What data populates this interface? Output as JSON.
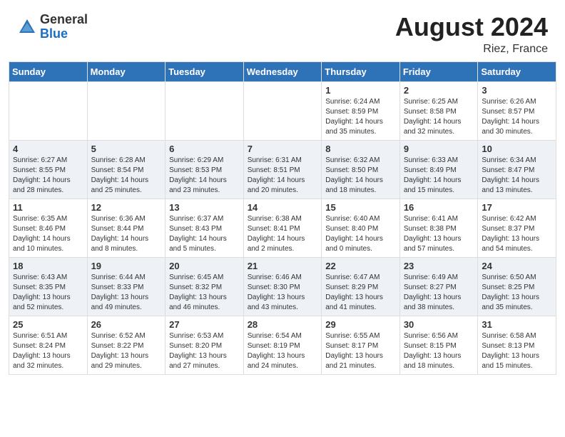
{
  "header": {
    "logo_general": "General",
    "logo_blue": "Blue",
    "month_year": "August 2024",
    "location": "Riez, France"
  },
  "weekdays": [
    "Sunday",
    "Monday",
    "Tuesday",
    "Wednesday",
    "Thursday",
    "Friday",
    "Saturday"
  ],
  "weeks": [
    [
      {
        "day": "",
        "info": ""
      },
      {
        "day": "",
        "info": ""
      },
      {
        "day": "",
        "info": ""
      },
      {
        "day": "",
        "info": ""
      },
      {
        "day": "1",
        "info": "Sunrise: 6:24 AM\nSunset: 8:59 PM\nDaylight: 14 hours\nand 35 minutes."
      },
      {
        "day": "2",
        "info": "Sunrise: 6:25 AM\nSunset: 8:58 PM\nDaylight: 14 hours\nand 32 minutes."
      },
      {
        "day": "3",
        "info": "Sunrise: 6:26 AM\nSunset: 8:57 PM\nDaylight: 14 hours\nand 30 minutes."
      }
    ],
    [
      {
        "day": "4",
        "info": "Sunrise: 6:27 AM\nSunset: 8:55 PM\nDaylight: 14 hours\nand 28 minutes."
      },
      {
        "day": "5",
        "info": "Sunrise: 6:28 AM\nSunset: 8:54 PM\nDaylight: 14 hours\nand 25 minutes."
      },
      {
        "day": "6",
        "info": "Sunrise: 6:29 AM\nSunset: 8:53 PM\nDaylight: 14 hours\nand 23 minutes."
      },
      {
        "day": "7",
        "info": "Sunrise: 6:31 AM\nSunset: 8:51 PM\nDaylight: 14 hours\nand 20 minutes."
      },
      {
        "day": "8",
        "info": "Sunrise: 6:32 AM\nSunset: 8:50 PM\nDaylight: 14 hours\nand 18 minutes."
      },
      {
        "day": "9",
        "info": "Sunrise: 6:33 AM\nSunset: 8:49 PM\nDaylight: 14 hours\nand 15 minutes."
      },
      {
        "day": "10",
        "info": "Sunrise: 6:34 AM\nSunset: 8:47 PM\nDaylight: 14 hours\nand 13 minutes."
      }
    ],
    [
      {
        "day": "11",
        "info": "Sunrise: 6:35 AM\nSunset: 8:46 PM\nDaylight: 14 hours\nand 10 minutes."
      },
      {
        "day": "12",
        "info": "Sunrise: 6:36 AM\nSunset: 8:44 PM\nDaylight: 14 hours\nand 8 minutes."
      },
      {
        "day": "13",
        "info": "Sunrise: 6:37 AM\nSunset: 8:43 PM\nDaylight: 14 hours\nand 5 minutes."
      },
      {
        "day": "14",
        "info": "Sunrise: 6:38 AM\nSunset: 8:41 PM\nDaylight: 14 hours\nand 2 minutes."
      },
      {
        "day": "15",
        "info": "Sunrise: 6:40 AM\nSunset: 8:40 PM\nDaylight: 14 hours\nand 0 minutes."
      },
      {
        "day": "16",
        "info": "Sunrise: 6:41 AM\nSunset: 8:38 PM\nDaylight: 13 hours\nand 57 minutes."
      },
      {
        "day": "17",
        "info": "Sunrise: 6:42 AM\nSunset: 8:37 PM\nDaylight: 13 hours\nand 54 minutes."
      }
    ],
    [
      {
        "day": "18",
        "info": "Sunrise: 6:43 AM\nSunset: 8:35 PM\nDaylight: 13 hours\nand 52 minutes."
      },
      {
        "day": "19",
        "info": "Sunrise: 6:44 AM\nSunset: 8:33 PM\nDaylight: 13 hours\nand 49 minutes."
      },
      {
        "day": "20",
        "info": "Sunrise: 6:45 AM\nSunset: 8:32 PM\nDaylight: 13 hours\nand 46 minutes."
      },
      {
        "day": "21",
        "info": "Sunrise: 6:46 AM\nSunset: 8:30 PM\nDaylight: 13 hours\nand 43 minutes."
      },
      {
        "day": "22",
        "info": "Sunrise: 6:47 AM\nSunset: 8:29 PM\nDaylight: 13 hours\nand 41 minutes."
      },
      {
        "day": "23",
        "info": "Sunrise: 6:49 AM\nSunset: 8:27 PM\nDaylight: 13 hours\nand 38 minutes."
      },
      {
        "day": "24",
        "info": "Sunrise: 6:50 AM\nSunset: 8:25 PM\nDaylight: 13 hours\nand 35 minutes."
      }
    ],
    [
      {
        "day": "25",
        "info": "Sunrise: 6:51 AM\nSunset: 8:24 PM\nDaylight: 13 hours\nand 32 minutes."
      },
      {
        "day": "26",
        "info": "Sunrise: 6:52 AM\nSunset: 8:22 PM\nDaylight: 13 hours\nand 29 minutes."
      },
      {
        "day": "27",
        "info": "Sunrise: 6:53 AM\nSunset: 8:20 PM\nDaylight: 13 hours\nand 27 minutes."
      },
      {
        "day": "28",
        "info": "Sunrise: 6:54 AM\nSunset: 8:19 PM\nDaylight: 13 hours\nand 24 minutes."
      },
      {
        "day": "29",
        "info": "Sunrise: 6:55 AM\nSunset: 8:17 PM\nDaylight: 13 hours\nand 21 minutes."
      },
      {
        "day": "30",
        "info": "Sunrise: 6:56 AM\nSunset: 8:15 PM\nDaylight: 13 hours\nand 18 minutes."
      },
      {
        "day": "31",
        "info": "Sunrise: 6:58 AM\nSunset: 8:13 PM\nDaylight: 13 hours\nand 15 minutes."
      }
    ]
  ]
}
